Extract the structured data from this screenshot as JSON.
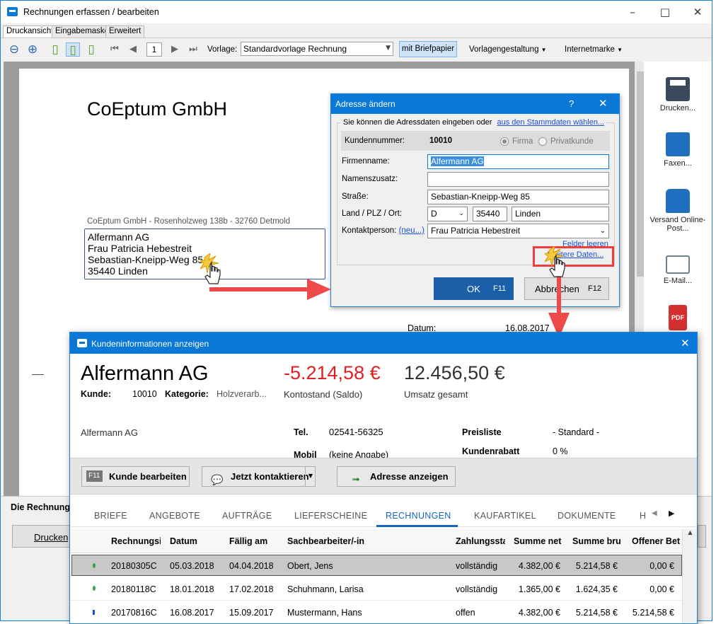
{
  "main": {
    "title": "Rechnungen erfassen / bearbeiten",
    "tabs": [
      "Druckansicht",
      "Eingabemaske",
      "Erweitert"
    ],
    "toolbar": {
      "page_number": "1",
      "vorlage_label": "Vorlage:",
      "vorlage_value": "Standardvorlage Rechnung",
      "briefpapier_label": "mit Briefpapier",
      "vorlagengestaltung_label": "Vorlagengestaltung",
      "internetmarke_label": "Internetmarke"
    },
    "sidebar": [
      {
        "label": "Drucken...",
        "icon": "printer-icon"
      },
      {
        "label": "Faxen...",
        "icon": "fax-icon"
      },
      {
        "label": "Versand Online-Post...",
        "icon": "mailbox-icon"
      },
      {
        "label": "E-Mail...",
        "icon": "email-icon"
      },
      {
        "label": "PDF",
        "icon": "pdf-icon"
      }
    ],
    "bottom": {
      "rechnung_label": "Die Rechnung",
      "drucken_label": "Drucken"
    }
  },
  "document": {
    "company": "CoEptum GmbH",
    "sender_line": "CoEptum GmbH - Rosenholzweg 138b - 32760 Detmold",
    "address_lines": [
      "Alfermann AG",
      "Frau Patricia Hebestreit",
      "Sebastian-Kneipp-Weg 85",
      "35440 Linden"
    ],
    "date_label": "Datum:",
    "date_value": "16.08.2017"
  },
  "address_dialog": {
    "title": "Adresse ändern",
    "help": "?",
    "intro_text": "Sie können die Adressdaten eingeben oder",
    "intro_link": "aus den Stammdaten wählen...",
    "kundennummer_label": "Kundennummer:",
    "kundennummer_value": "10010",
    "radio_firma": "Firma",
    "radio_privat": "Privatkunde",
    "firmenname_label": "Firmenname:",
    "firmenname_value": "Alfermann AG",
    "namenszusatz_label": "Namenszusatz:",
    "namenszusatz_value": "",
    "strasse_label": "Straße:",
    "strasse_value": "Sebastian-Kneipp-Weg 85",
    "ort_label": "Land / PLZ / Ort:",
    "land_value": "D",
    "plz_value": "35440",
    "ort_value": "Linden",
    "kontakt_label": "Kontaktperson:",
    "kontakt_link": "(neu...)",
    "kontakt_value": "Frau Patricia Hebestreit",
    "felder_leeren": "Felder leeren",
    "weitere_daten": "Weitere Daten...",
    "ok_label": "OK",
    "ok_key": "F11",
    "cancel_label": "Abbrechen",
    "cancel_key": "F12"
  },
  "info_window": {
    "title": "Kundeninformationen anzeigen",
    "name": "Alfermann AG",
    "kunde_label": "Kunde:",
    "kunde_value": "10010",
    "kategorie_label": "Kategorie:",
    "kategorie_value": "Holzverarb...",
    "saldo_value": "-5.214,58 €",
    "saldo_label": "Kontostand (Saldo)",
    "umsatz_value": "12.456,50 €",
    "umsatz_label": "Umsatz gesamt",
    "address_name": "Alfermann AG",
    "tel_label": "Tel.",
    "tel_value": "02541-56325",
    "mobil_label": "Mobil",
    "mobil_value": "(keine Angabe)",
    "preisliste_label": "Preisliste",
    "preisliste_value": "- Standard -",
    "rabatt_label": "Kundenrabatt",
    "rabatt_value": "0 %",
    "btn_bearbeiten_key": "F11",
    "btn_bearbeiten": "Kunde bearbeiten",
    "btn_kontakt": "Jetzt kontaktieren",
    "btn_adresse": "Adresse anzeigen",
    "tabs": [
      "BRIEFE",
      "ANGEBOTE",
      "AUFTRÄGE",
      "LIEFERSCHEINE",
      "RECHNUNGEN",
      "KAUFARTIKEL",
      "DOKUMENTE",
      "H"
    ],
    "columns": [
      "Rechnungsi",
      "Datum",
      "Fällig am",
      "Sachbearbeiter/-in",
      "Zahlungssta",
      "Summe net",
      "Summe bru",
      "Offener Bet"
    ],
    "rows": [
      [
        "20180305C",
        "05.03.2018",
        "04.04.2018",
        "Obert, Jens",
        "vollständig",
        "4.382,00 €",
        "5.214,58 €",
        "0,00 €"
      ],
      [
        "20180118C",
        "18.01.2018",
        "17.02.2018",
        "Schuhmann, Larisa",
        "vollständig",
        "1.365,00 €",
        "1.624,35 €",
        "0,00 €"
      ],
      [
        "20170816C",
        "16.08.2017",
        "15.09.2017",
        "Mustermann, Hans",
        "offen",
        "4.382,00 €",
        "5.214,58 €",
        "5.214,58 €"
      ]
    ]
  },
  "colors": {
    "accent": "#0a78d7",
    "negative": "#e02020",
    "annotation": "#ef4a4a",
    "active_tab": "#1565c0"
  }
}
